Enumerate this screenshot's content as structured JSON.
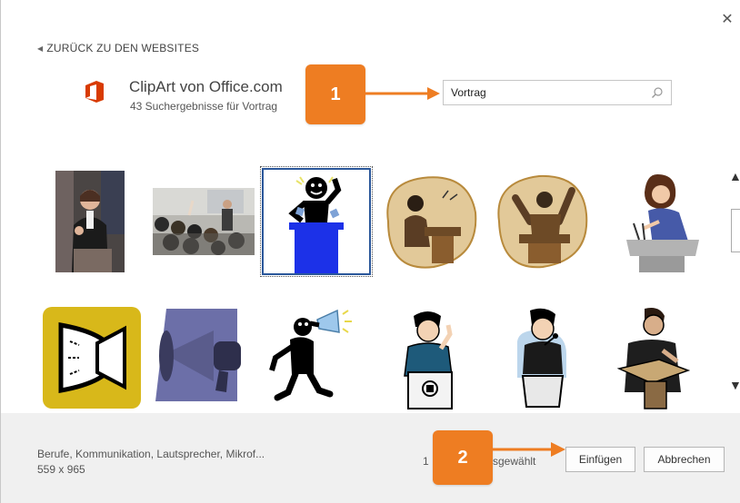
{
  "dialog": {
    "close_icon": "close-icon"
  },
  "nav": {
    "back_label": "ZURÜCK ZU DEN WEBSITES",
    "back_icon": "chevron-left-icon"
  },
  "source": {
    "logo": "office-logo",
    "title": "ClipArt von Office.com",
    "result_summary": "43 Suchergebnisse für Vortrag"
  },
  "search": {
    "value": "Vortrag",
    "icon": "search-icon"
  },
  "callouts": {
    "step1": "1",
    "step2": "2"
  },
  "results": {
    "items": [
      {
        "name": "speaker-woman-photo",
        "selected": false
      },
      {
        "name": "classroom-photo",
        "selected": false
      },
      {
        "name": "speaker-podium-clipart",
        "selected": true
      },
      {
        "name": "woman-lecture-clipart",
        "selected": false
      },
      {
        "name": "man-lecture-clipart",
        "selected": false
      },
      {
        "name": "woman-podium-clipart",
        "selected": false
      },
      {
        "name": "megaphone-yellow-clipart",
        "selected": false
      },
      {
        "name": "megaphone-purple-clipart",
        "selected": false
      },
      {
        "name": "person-megaphone-clipart",
        "selected": false
      },
      {
        "name": "man-thinking-podium-clipart",
        "selected": false
      },
      {
        "name": "man-microphone-clipart",
        "selected": false
      },
      {
        "name": "man-lectern-clipart",
        "selected": false
      }
    ]
  },
  "footer": {
    "tags": "Berufe, Kommunikation, Lautsprecher, Mikrof...",
    "dimensions": "559 x 965",
    "count_visible": "1",
    "selected_fragment": "sgewählt",
    "insert_label": "Einfügen",
    "cancel_label": "Abbrechen"
  },
  "colors": {
    "accent": "#ee7d22",
    "selection": "#2b579a",
    "office_red": "#d83b01"
  }
}
